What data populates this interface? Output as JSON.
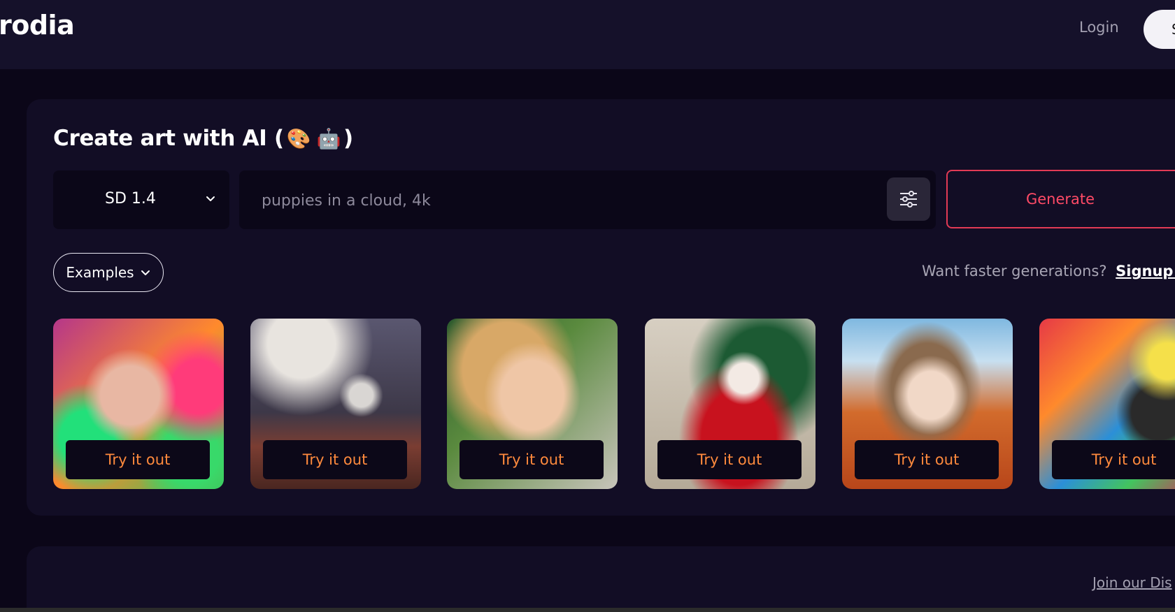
{
  "header": {
    "brand": "rodia",
    "login_label": "Login",
    "signup_label": "S"
  },
  "creator": {
    "heading": "Create art with AI (",
    "heading_emoji_1": "🎨",
    "heading_emoji_2": "🤖",
    "heading_close": ")",
    "model_selected": "SD 1.4",
    "prompt_placeholder": "puppies in a cloud, 4k",
    "generate_label": "Generate",
    "examples_label": "Examples",
    "promo_text": "Want faster generations?",
    "promo_link": "Signup for"
  },
  "examples": [
    {
      "button": "Try it out",
      "icon": "colorful-portrait-image"
    },
    {
      "button": "Try it out",
      "icon": "astronaut-horse-image"
    },
    {
      "button": "Try it out",
      "icon": "blonde-woman-image"
    },
    {
      "button": "Try it out",
      "icon": "santa-claus-image"
    },
    {
      "button": "Try it out",
      "icon": "anime-girl-autumn-image"
    },
    {
      "button": "Try it out",
      "icon": "psychedelic-tree-image"
    }
  ],
  "footer": {
    "discord_link": "Join our Dis"
  },
  "colors": {
    "background": "#0b0618",
    "header": "#15112a",
    "card": "#120d25",
    "accent_red": "#e23a55",
    "try_orange": "#ff8a3d"
  }
}
